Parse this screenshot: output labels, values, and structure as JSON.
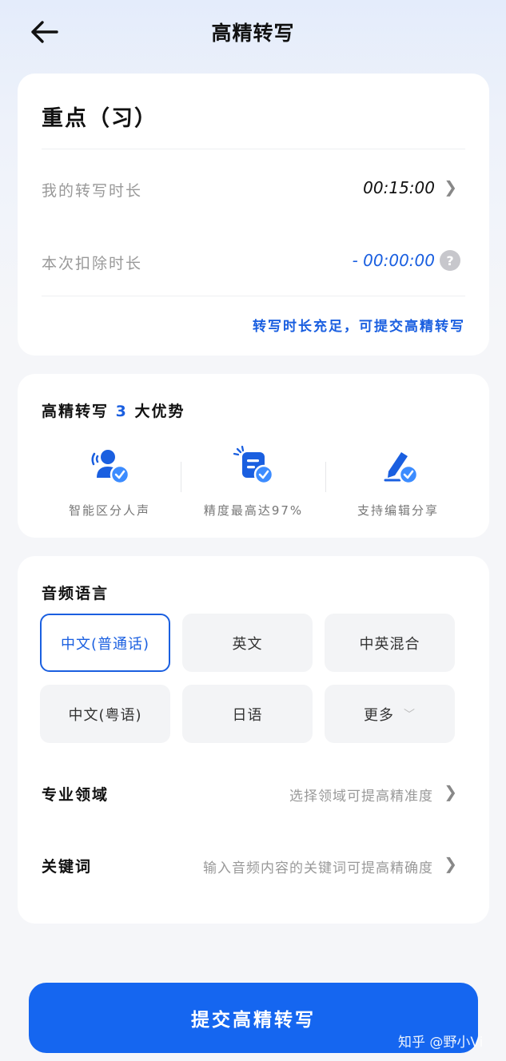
{
  "header": {
    "title": "高精转写",
    "back_icon": "arrow-left-icon"
  },
  "file": {
    "name": "重点（习）",
    "my_duration_label": "我的转写时长",
    "my_duration_value": "00:15:00",
    "deduct_label": "本次扣除时长",
    "deduct_value": "- 00:00:00",
    "notice": "转写时长充足，可提交高精转写"
  },
  "advantages": {
    "title_prefix": "高精转写",
    "title_num": "3",
    "title_suffix": "大优势",
    "items": [
      {
        "label": "智能区分人声",
        "icon": "speaker-person-icon"
      },
      {
        "label": "精度最高达97%",
        "icon": "document-check-icon"
      },
      {
        "label": "支持编辑分享",
        "icon": "edit-pen-icon"
      }
    ]
  },
  "language": {
    "title": "音频语言",
    "options": [
      "中文(普通话)",
      "英文",
      "中英混合",
      "中文(粤语)",
      "日语",
      "更多"
    ],
    "selected": "中文(普通话)"
  },
  "domain": {
    "label": "专业领域",
    "hint": "选择领域可提高精准度"
  },
  "keywords": {
    "label": "关键词",
    "hint": "输入音频内容的关键词可提高精确度"
  },
  "submit_label": "提交高精转写",
  "watermark": "知乎 @野小Vi",
  "colors": {
    "accent": "#1a5fe0",
    "button": "#1566f0"
  }
}
